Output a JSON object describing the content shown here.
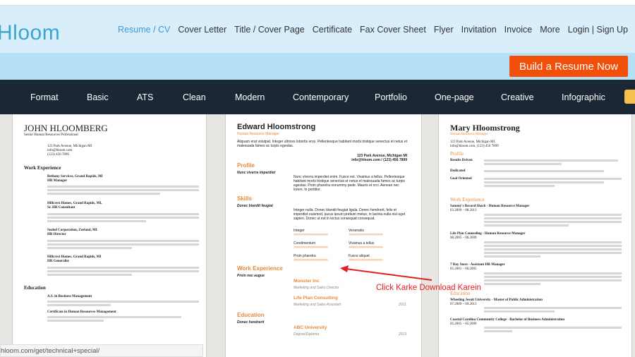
{
  "header": {
    "logo": "Hloom",
    "nav": [
      "Resume / CV",
      "Cover Letter",
      "Title / Cover Page",
      "Certificate",
      "Fax Cover Sheet",
      "Flyer",
      "Invitation",
      "Invoice",
      "More",
      "Login | Sign Up"
    ],
    "cta": "Build a Resume Now"
  },
  "categories": [
    "Format",
    "Basic",
    "ATS",
    "Clean",
    "Modern",
    "Contemporary",
    "Portfolio",
    "One-page",
    "Creative",
    "Infographic"
  ],
  "colors": {
    "accent": "#3d9ad6",
    "cta": "#f2500a",
    "nav_bg": "#1b2734",
    "resume_orange": "#e8883a",
    "annotation": "#e32020"
  },
  "resume1": {
    "name": "JOHN HLOOMBERG",
    "title": "Senior Human Resources Professional",
    "address": "123 Park Avenue, Michigan MI",
    "email": "info@hloom.com",
    "phone": "(123) 456 7899",
    "work_heading": "Work Experience",
    "jobs": [
      {
        "company": "Bethany Services, Grand Rapids, MI",
        "role": "HR Manager"
      },
      {
        "company": "Hillcrest Homes, Grand Rapids, MI,",
        "role": "Sr. HR Consultant"
      },
      {
        "company": "Sealed Corporation, Zeeland, MI",
        "role": "HR Director"
      },
      {
        "company": "Hillcrest Homes, Grand Rapids, MI",
        "role": "HR Generalist"
      }
    ],
    "education_heading": "Education",
    "education": [
      "A.S. in Business Management",
      "Certificate in Human Resources Management"
    ]
  },
  "resume2": {
    "name": "Edward Hloomstrong",
    "title": "Human Resource Manager",
    "intro": "Aliquam erat volutpat. Integer ultrices lobortis eros. Pellentesque habitant morbi tristique senectus et netus et malesuada fames ac turpis egestas.",
    "address": "123 Park Avenue, Michigan MI",
    "contact": "info@hloom.com / (123) 456 7899",
    "profile_heading": "Profile",
    "profile_sub": "Nunc viverra imperdiet",
    "profile_text": "Nunc viverra imperdiet enim. Fusce est. Vivamus a tellus. Pellentesque habitant morbi tristique senectus et netus et malesuada fames ac turpis egestas. Proin pharetra nonummy pede. Mauris et orci. Aenean nec lorem. In porttitor.",
    "skills_heading": "Skills",
    "skills_sub": "Donec blandit feugiat",
    "skills_text": "Integer nulla. Donec blandit feugiat ligula. Donec hendrerit, felis et imperdiet euismod, purus ipsum pretium metus, in lacinia nulla nisl eget sapien. Donec ut est in lectus consequat consequat.",
    "skills": [
      {
        "name": "Integer",
        "arrows": ">>>>>>>>>>>>>>>>>>>>"
      },
      {
        "name": "Venenatis",
        "arrows": ">>>>>>>>>>>>>>>>>>>>"
      },
      {
        "name": "Condimentum",
        "arrows": ">>>>>>>>>>>>>>>>>>>>"
      },
      {
        "name": "Vivamus a tellus",
        "arrows": ">>>>>>>>>>>>>>>>>>>>"
      },
      {
        "name": "Proin pharetra",
        "arrows": ">>>>>>>>>>>>>>>>>>>>"
      },
      {
        "name": "Fusce aliquet",
        "arrows": ">>>>>>>>>>>>>>>>>>>>"
      }
    ],
    "work_heading": "Work Experience",
    "work_sub": "Proin nec augue",
    "jobs": [
      {
        "company": "Monster Inc",
        "role": "Marketing and Sales Director",
        "year": ""
      },
      {
        "company": "Life Plan Consulting",
        "role": "Marketing and Sales Assistant",
        "year": "2011"
      }
    ],
    "education_heading": "Education",
    "education_sub": "Donec hendrerit",
    "education": [
      {
        "school": "ABC University",
        "degree": "Degree/Diploma",
        "year": "2013"
      }
    ]
  },
  "resume3": {
    "name": "Mary Hloomstrong",
    "title": "Human Resource Manager",
    "address": "123 Park Avenue, Michigan MI",
    "contact": "info@hloom.com, (123) 456 7899",
    "profile_heading": "Profile",
    "traits": [
      "Results Driven",
      "Dedicated",
      "Goal Oriented"
    ],
    "work_heading": "Work Experience",
    "jobs": [
      {
        "title": "Sammy's Record Shack - Human Resource Manager",
        "dates": "03.2009 – 08.2013"
      },
      {
        "title": "Life Plan Counseling - Human Resource Manager",
        "dates": "08.2005 – 08.2009"
      },
      {
        "title": "7 Day Store - Assistant HR Manager",
        "dates": "05.2001 – 06.2005"
      }
    ],
    "education_heading": "Education",
    "education": [
      {
        "title": "Wheeling Jesuit University - Master of Public Administration",
        "dates": "07.2009 – 09.2013"
      },
      {
        "title": "Coastal Carolina Community College - Bachelor of Business Administration",
        "dates": "05.2005 – 05.2009"
      }
    ]
  },
  "annotation": "Click Karke Download Karein",
  "status_url": "hloom.com/get/technical+special/"
}
